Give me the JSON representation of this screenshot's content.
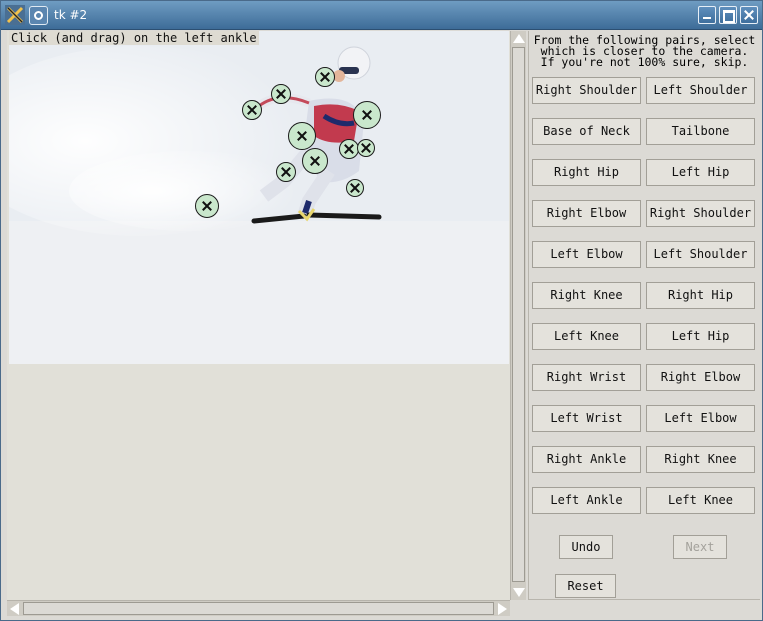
{
  "window": {
    "title": "tk #2"
  },
  "canvas": {
    "instruction": "Click (and drag) on the left ankle"
  },
  "panel": {
    "prompt_lines": [
      "From the following pairs, select",
      "which is closer to the camera.",
      "If you're not 100% sure, skip."
    ],
    "pairs": [
      [
        "Right Shoulder",
        "Left Shoulder"
      ],
      [
        "Base of Neck",
        "Tailbone"
      ],
      [
        "Right Hip",
        "Left Hip"
      ],
      [
        "Right Elbow",
        "Right Shoulder"
      ],
      [
        "Left Elbow",
        "Left Shoulder"
      ],
      [
        "Right Knee",
        "Right Hip"
      ],
      [
        "Left Knee",
        "Left Hip"
      ],
      [
        "Right Wrist",
        "Right Elbow"
      ],
      [
        "Left Wrist",
        "Left Elbow"
      ],
      [
        "Right Ankle",
        "Right Knee"
      ],
      [
        "Left Ankle",
        "Left Knee"
      ]
    ],
    "undo_label": "Undo",
    "next_label": "Next",
    "reset_label": "Reset"
  },
  "icons": {
    "app": "app-x-icon",
    "menu": "window-menu-icon",
    "minimize": "minimize-icon",
    "maximize": "maximize-icon",
    "close": "close-icon",
    "keypoint": "keypoint-marker-icon"
  },
  "colors": {
    "titlebar": "#3d6c98",
    "keypoint_fill": "#c9e7cc",
    "disabled_text": "#a4a29c"
  }
}
